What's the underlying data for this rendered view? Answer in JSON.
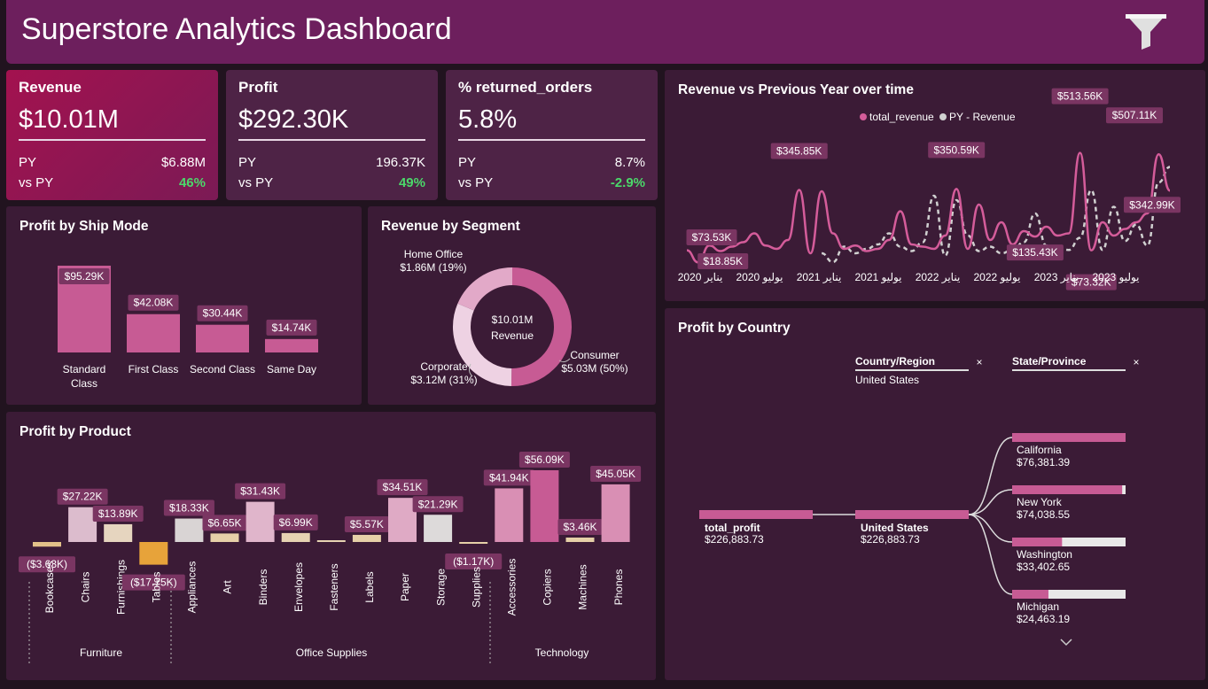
{
  "header": {
    "title": "Superstore Analytics Dashboard"
  },
  "kpis": [
    {
      "title": "Revenue",
      "value": "$10.01M",
      "py_label": "PY",
      "py_value": "$6.88M",
      "vs_label": "vs PY",
      "vs_value": "46%"
    },
    {
      "title": "Profit",
      "value": "$292.30K",
      "py_label": "PY",
      "py_value": "196.37K",
      "vs_label": "vs PY",
      "vs_value": "49%"
    },
    {
      "title": "% returned_orders",
      "value": "5.8%",
      "py_label": "PY",
      "py_value": "8.7%",
      "vs_label": "vs PY",
      "vs_value": "-2.9%"
    }
  ],
  "ship_mode": {
    "title": "Profit by Ship Mode",
    "chart_data": {
      "type": "bar",
      "categories": [
        "Standard Class",
        "First Class",
        "Second Class",
        "Same Day"
      ],
      "values": [
        95.29,
        42.08,
        30.44,
        14.74
      ],
      "labels": [
        "$95.29K",
        "$42.08K",
        "$30.44K",
        "$14.74K"
      ],
      "ylabel": "",
      "color": "#c75b94"
    }
  },
  "segment": {
    "title": "Revenue by Segment",
    "center_value": "$10.01M",
    "center_label": "Revenue",
    "chart_data": {
      "type": "pie",
      "categories": [
        "Consumer",
        "Corporate",
        "Home Office"
      ],
      "values": [
        5.03,
        3.12,
        1.86
      ],
      "labels": [
        "$5.03M (50%)",
        "$3.12M (31%)",
        "$1.86M (19%)"
      ],
      "colors": [
        "#c75b94",
        "#eed2e3",
        "#e2a9c8"
      ]
    }
  },
  "revenue_time": {
    "title": "Revenue vs Previous Year over time",
    "legend": [
      "total_revenue",
      "PY - Revenue"
    ],
    "x_ticks": [
      "يناير 2020",
      "يوليو 2020",
      "يناير 2021",
      "يوليو 2021",
      "يناير 2022",
      "يوليو 2022",
      "يناير 2023",
      "يوليو 2023"
    ],
    "chart_data": {
      "type": "line",
      "series": [
        {
          "name": "total_revenue",
          "color": "#d45c9a",
          "values": [
            73.53,
            18.85,
            95,
            70,
            90,
            110,
            150,
            95,
            80,
            120,
            345.85,
            60,
            340,
            150,
            80,
            95,
            70,
            80,
            120,
            250,
            100,
            90,
            80,
            140,
            350.59,
            80,
            280,
            120,
            200,
            100,
            160,
            135.43,
            180,
            140,
            150,
            513.56,
            73.32,
            200,
            140,
            170,
            200,
            240,
            507.11,
            342.99
          ]
        },
        {
          "name": "PY - Revenue",
          "color": "#d0d0d0",
          "values": [
            null,
            null,
            null,
            null,
            null,
            null,
            null,
            null,
            null,
            null,
            null,
            null,
            60,
            20,
            90,
            60,
            80,
            100,
            150,
            90,
            70,
            110,
            320,
            50,
            300,
            140,
            70,
            90,
            60,
            75,
            110,
            240,
            95,
            85,
            75,
            130,
            345,
            75,
            270,
            115,
            190,
            95,
            380,
            450
          ]
        }
      ],
      "data_labels": [
        "$73.53K",
        "$18.85K",
        "$345.85K",
        "$350.59K",
        "$135.43K",
        "$513.56K",
        "$73.32K",
        "$507.11K",
        "$342.99K"
      ]
    }
  },
  "product": {
    "title": "Profit by Product",
    "chart_data": {
      "type": "bar",
      "categories": [
        "Bookcases",
        "Chairs",
        "Furnishings",
        "Tables",
        "Appliances",
        "Art",
        "Binders",
        "Envelopes",
        "Fasteners",
        "Labels",
        "Paper",
        "Storage",
        "Supplies",
        "Accessories",
        "Copiers",
        "Machines",
        "Phones"
      ],
      "groups": [
        "Furniture",
        "Office Supplies",
        "Technology"
      ],
      "values": [
        -3.63,
        27.22,
        13.89,
        -17.75,
        18.33,
        6.65,
        31.43,
        6.99,
        0.95,
        5.57,
        34.51,
        21.29,
        -1.17,
        41.94,
        56.09,
        3.46,
        45.05
      ],
      "labels": [
        "($3.63K)",
        "$27.22K",
        "$13.89K",
        "($17.75K)",
        "$18.33K",
        "$6.65K",
        "$31.43K",
        "$6.99K",
        "",
        "$5.57K",
        "$34.51K",
        "$21.29K",
        "($1.17K)",
        "$41.94K",
        "$56.09K",
        "$3.46K",
        "$45.05K"
      ],
      "colors": [
        "#e3c189",
        "#dcbccd",
        "#e6d5bf",
        "#e7a33a",
        "#d9d4d4",
        "#e6d0a8",
        "#e0b5cb",
        "#e6d3b2",
        "#e6d3b2",
        "#e6d0a8",
        "#dfaac5",
        "#dddada",
        "#e6d0a8",
        "#d98fb4",
        "#c75b94",
        "#e6d0a8",
        "#d98fb4"
      ]
    }
  },
  "country": {
    "title": "Profit by Country",
    "filter1_label": "Country/Region",
    "filter1_value": "United States",
    "filter2_label": "State/Province",
    "root_label": "total_profit",
    "root_value": "$226,883.73",
    "mid_label": "United States",
    "mid_value": "$226,883.73",
    "states": [
      {
        "name": "California",
        "value": "$76,381.39",
        "fraction": 1.0
      },
      {
        "name": "New York",
        "value": "$74,038.55",
        "fraction": 0.97
      },
      {
        "name": "Washington",
        "value": "$33,402.65",
        "fraction": 0.44
      },
      {
        "name": "Michigan",
        "value": "$24,463.19",
        "fraction": 0.32
      }
    ]
  }
}
